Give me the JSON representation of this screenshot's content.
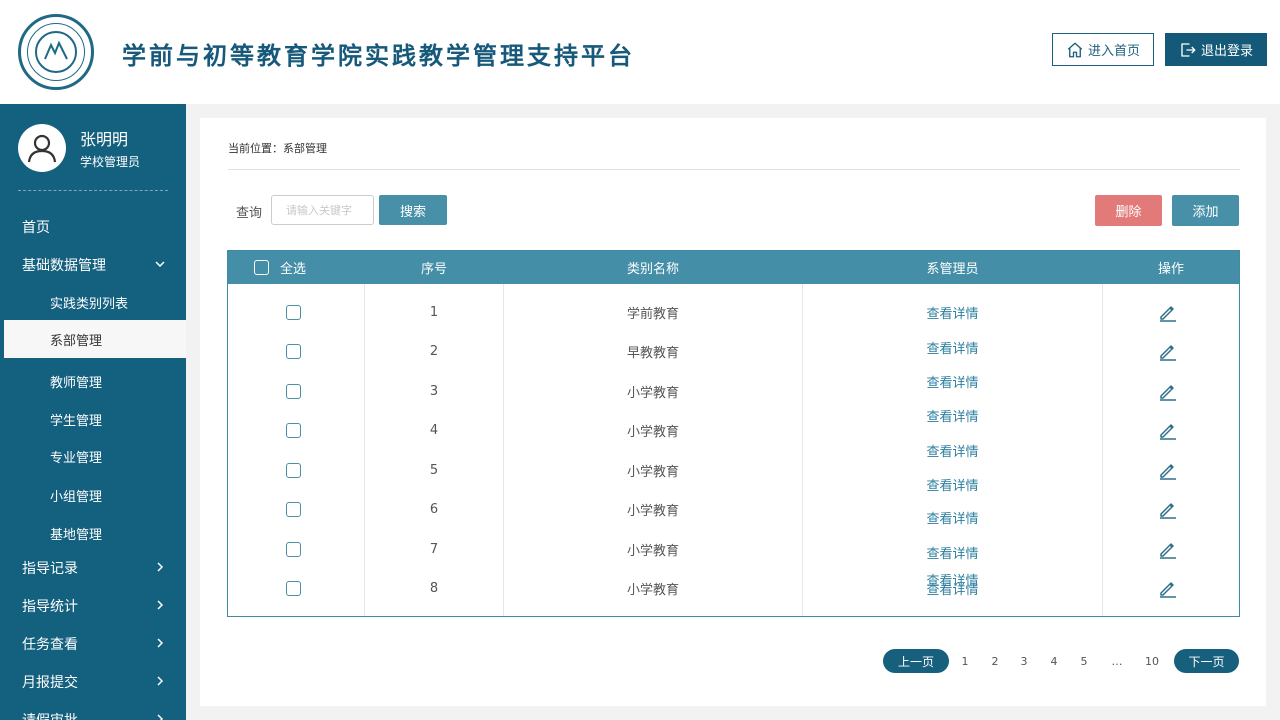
{
  "header": {
    "title": "学前与初等教育学院实践教学管理支持平台",
    "home_label": "进入首页",
    "logout_label": "退出登录",
    "brand_color": "#16597a"
  },
  "user": {
    "name": "张明明",
    "role": "学校管理员"
  },
  "sidebar": {
    "items": [
      {
        "label": "首页"
      },
      {
        "label": "基础数据管理"
      },
      {
        "label": "实践类别列表"
      },
      {
        "label": "系部管理"
      },
      {
        "label": "教师管理"
      },
      {
        "label": "学生管理"
      },
      {
        "label": "专业管理"
      },
      {
        "label": "小组管理"
      },
      {
        "label": "基地管理"
      },
      {
        "label": "指导记录"
      },
      {
        "label": "指导统计"
      },
      {
        "label": "任务查看"
      },
      {
        "label": "月报提交"
      },
      {
        "label": "请假审批"
      }
    ],
    "bg_color": "#14607f"
  },
  "breadcrumb": "当前位置：系部管理",
  "search": {
    "label": "查询",
    "placeholder": "请输入关键字",
    "button": "搜索"
  },
  "actions": {
    "delete": "删除",
    "add": "添加"
  },
  "table": {
    "headers": [
      "全选",
      "序号",
      "类别名称",
      "系管理员",
      "操作"
    ],
    "rows": [
      {
        "no": "1",
        "name": "学前教育",
        "admin": "查看详情"
      },
      {
        "no": "2",
        "name": "早教教育",
        "admin": "查看详情"
      },
      {
        "no": "3",
        "name": "小学教育",
        "admin": "查看详情"
      },
      {
        "no": "4",
        "name": "小学教育",
        "admin": "查看详情"
      },
      {
        "no": "5",
        "name": "小学教育",
        "admin": "查看详情"
      },
      {
        "no": "6",
        "name": "小学教育",
        "admin": "查看详情"
      },
      {
        "no": "7",
        "name": "小学教育",
        "admin": "查看详情"
      },
      {
        "no": "8",
        "name": "小学教育",
        "admin": "查看详情"
      }
    ],
    "extra_admin_links": [
      "查看详情",
      "查看详情"
    ],
    "action_icon": "edit-icon",
    "header_color": "#448ea7"
  },
  "pagination": {
    "prev": "上一页",
    "pages": [
      "1",
      "2",
      "3",
      "4",
      "5",
      "…",
      "10"
    ],
    "next": "下一页"
  }
}
